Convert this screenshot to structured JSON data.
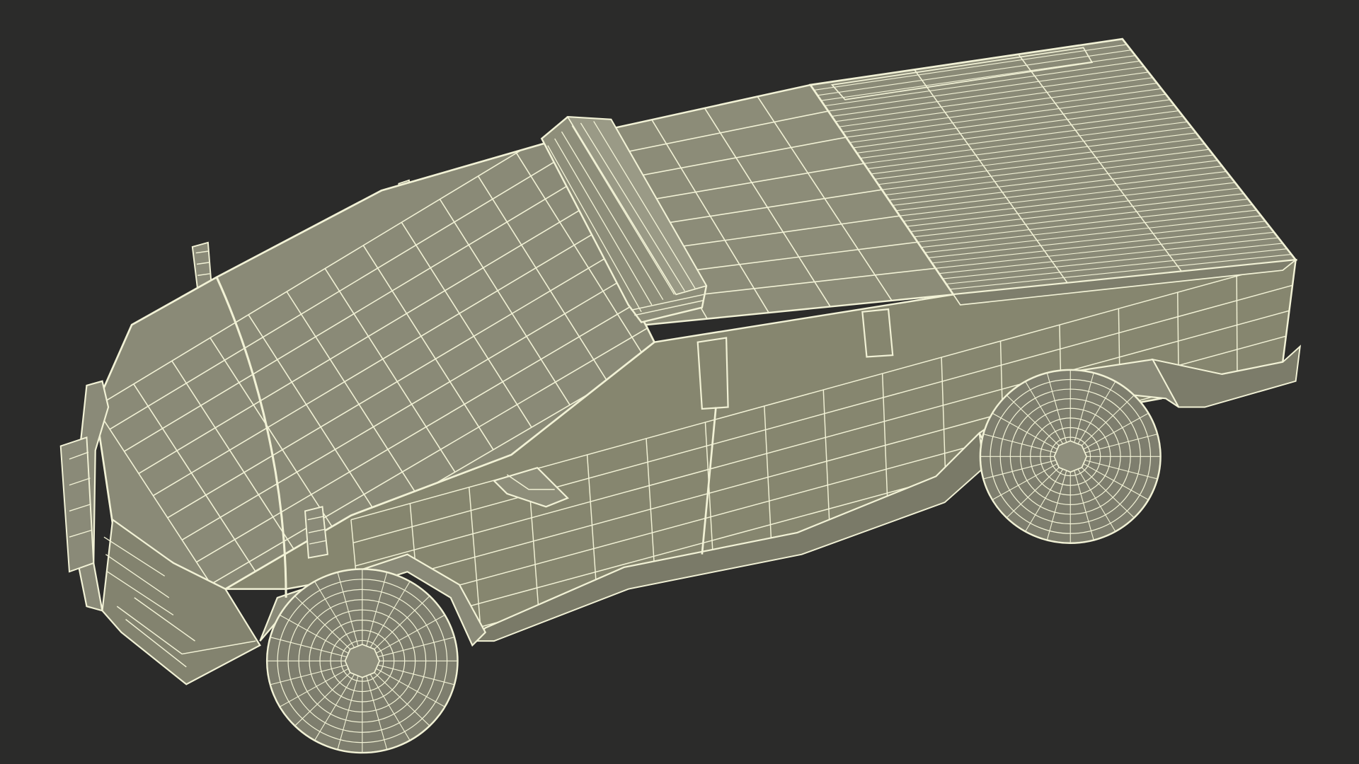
{
  "scene": {
    "subject": "wireframe-pickup-truck",
    "colors": {
      "background": "#2b2b2a",
      "surface_body": "#8a8a78",
      "surface_light": "#9b9b88",
      "surface_dark": "#6d6d5e",
      "wire": "#f2f2d6",
      "wheel": "#7e7e6e"
    }
  }
}
